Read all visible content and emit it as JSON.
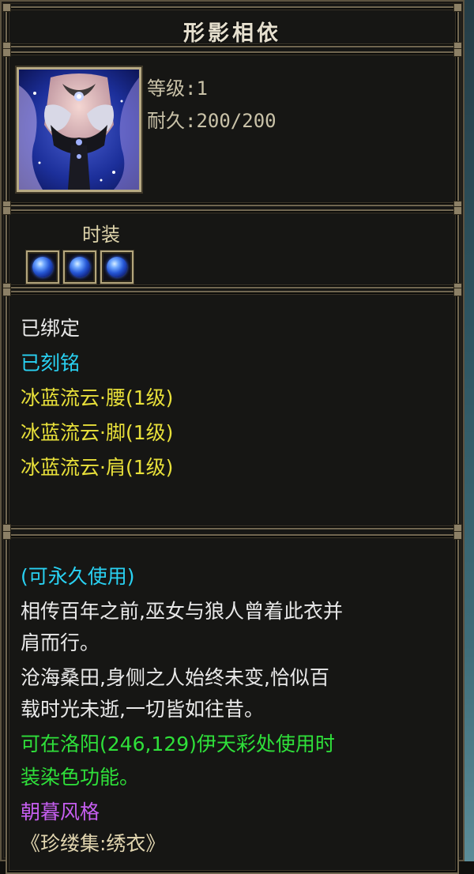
{
  "title": "形影相依",
  "item": {
    "icon": "costume-portrait-icon",
    "level_text": "等级:1",
    "durability_text": "耐久:200/200"
  },
  "type": {
    "label": "时装",
    "gems": [
      "blue-gem-icon",
      "blue-gem-icon",
      "blue-gem-icon"
    ]
  },
  "attributes": [
    {
      "text": "已绑定",
      "color": "#e9e9e9"
    },
    {
      "text": "已刻铭",
      "color": "#29d1f2"
    },
    {
      "text": "冰蓝流云·腰(1级)",
      "color": "#e8e03a"
    },
    {
      "text": "冰蓝流云·脚(1级)",
      "color": "#e8e03a"
    },
    {
      "text": "冰蓝流云·肩(1级)",
      "color": "#e8e03a"
    }
  ],
  "description": {
    "usage": "(可永久使用)",
    "lore_1a": "相传百年之前,巫女与狼人曾着此衣并",
    "lore_1b": "肩而行。",
    "lore_2a": "沧海桑田,身侧之人始终未变,恰似百",
    "lore_2b": "载时光未逝,一切皆如往昔。",
    "dye_a": "可在洛阳(246,129)伊天彩处使用时",
    "dye_b": "装染色功能。",
    "style": "朝暮风格",
    "collection": "《珍缕集:绣衣》"
  },
  "colors": {
    "white": "#e9e9e9",
    "cyan": "#29d1f2",
    "yellow": "#e8e03a",
    "green": "#2fe03a",
    "purple": "#c65ef0",
    "border_gold": "#706650"
  }
}
